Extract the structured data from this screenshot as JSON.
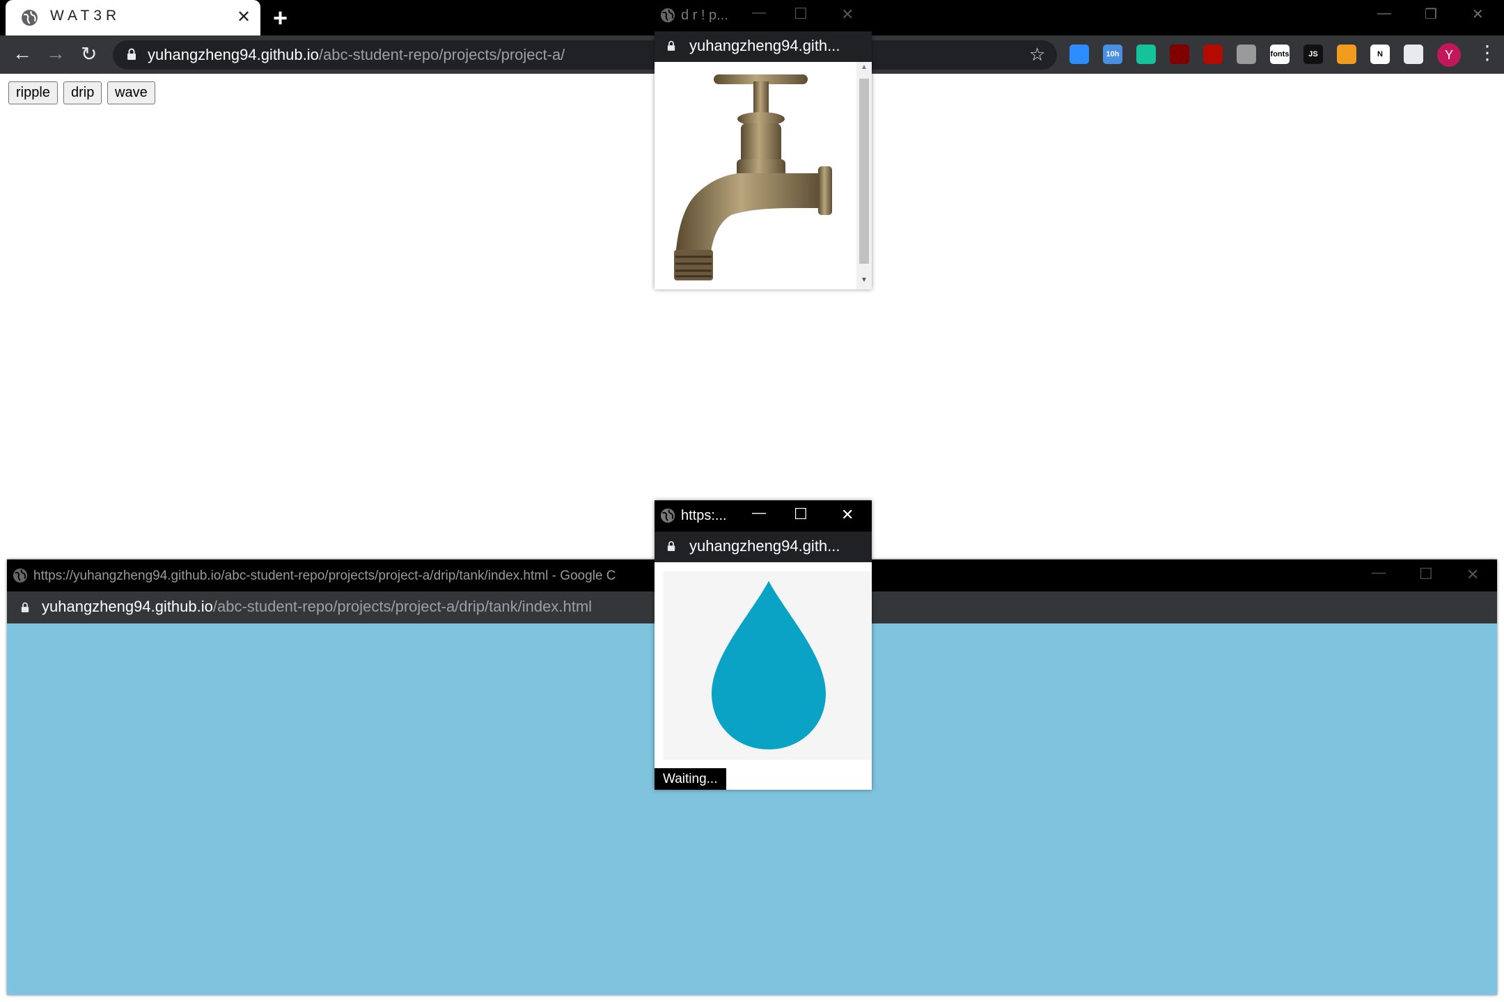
{
  "main_browser": {
    "tab_title": "WAT3R",
    "url_host": "yuhangzheng94.github.io",
    "url_path": "/abc-student-repo/projects/project-a/",
    "profile_initial": "Y",
    "extensions": [
      {
        "name": "zoom-extension-icon",
        "color": "#2d8cff",
        "label": ""
      },
      {
        "name": "calendar-extension-icon",
        "color": "#4a90e2",
        "label": "10h"
      },
      {
        "name": "grammarly-extension-icon",
        "color": "#15c39a",
        "label": ""
      },
      {
        "name": "ublock-extension-icon",
        "color": "#800000",
        "label": ""
      },
      {
        "name": "pdf-extension-icon",
        "color": "#b30b00",
        "label": ""
      },
      {
        "name": "copy-extension-icon",
        "color": "#9a9a9a",
        "label": ""
      },
      {
        "name": "fonts-extension-icon",
        "color": "#ffffff",
        "label": "fonts"
      },
      {
        "name": "js-extension-icon",
        "color": "#111111",
        "label": "JS"
      },
      {
        "name": "tool-extension-icon",
        "color": "#f29c1f",
        "label": ""
      },
      {
        "name": "notion-extension-icon",
        "color": "#ffffff",
        "label": "N"
      },
      {
        "name": "puzzle-extension-icon",
        "color": "#e8eaed",
        "label": ""
      }
    ]
  },
  "page": {
    "buttons": [
      "ripple",
      "drip",
      "wave"
    ]
  },
  "faucet_popup": {
    "title": "d r ! p...",
    "url": "yuhangzheng94.gith..."
  },
  "drop_popup": {
    "title": "https:...",
    "url": "yuhangzheng94.gith...",
    "status": "Waiting...",
    "drop_color": "#0aa3c6"
  },
  "tank_window": {
    "title": "https://yuhangzheng94.github.io/abc-student-repo/projects/project-a/drip/tank/index.html - Google C",
    "url_host": "yuhangzheng94.github.io",
    "url_path": "/abc-student-repo/projects/project-a/drip/tank/index.html",
    "water_color": "#7fc3de"
  }
}
